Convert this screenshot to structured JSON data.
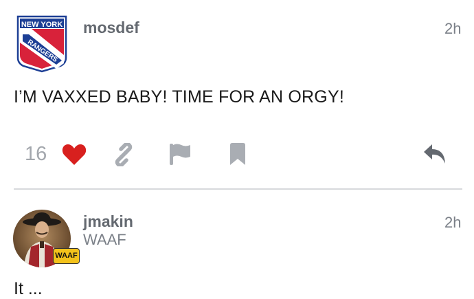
{
  "post1": {
    "username": "mosdef",
    "time": "2h",
    "body": "I’M VAXXED BABY! TIME FOR AN ORGY!",
    "like_count": "16",
    "avatar_icon": "new-york-rangers-logo",
    "avatar_text_top": "NEW YORK",
    "avatar_text_band": "RANGERS",
    "colors": {
      "heart": "#d8201e",
      "action_gray": "#a9adb3",
      "reply": "#646970"
    }
  },
  "post2": {
    "username": "jmakin",
    "time": "2h",
    "user_title": "WAAF",
    "flair": "WAAF",
    "avatar_icon": "cowboy-avatar",
    "body_cut": "It ..."
  }
}
